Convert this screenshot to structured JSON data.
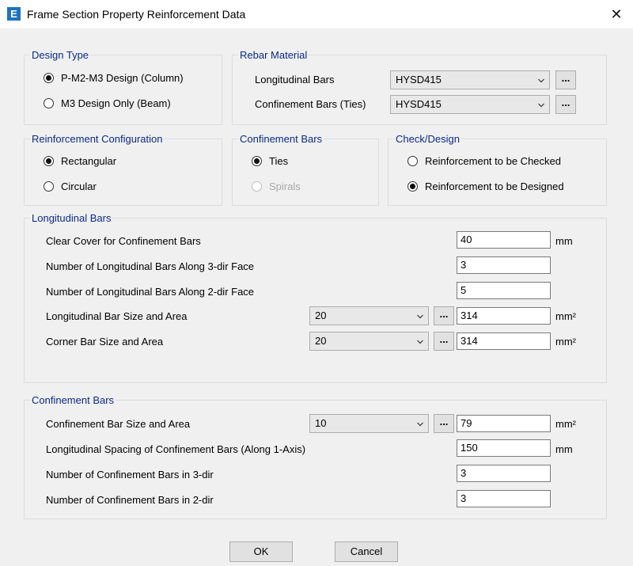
{
  "window": {
    "title": "Frame Section Property Reinforcement Data",
    "close_symbol": "✕"
  },
  "design_type": {
    "legend": "Design Type",
    "options": [
      {
        "label": "P-M2-M3 Design  (Column)",
        "selected": true
      },
      {
        "label": "M3 Design Only  (Beam)",
        "selected": false
      }
    ]
  },
  "rebar_material": {
    "legend": "Rebar Material",
    "longitudinal_label": "Longitudinal Bars",
    "longitudinal_value": "HYSD415",
    "confinement_label": "Confinement Bars (Ties)",
    "confinement_value": "HYSD415"
  },
  "reinforcement_configuration": {
    "legend": "Reinforcement Configuration",
    "options": [
      {
        "label": "Rectangular",
        "selected": true
      },
      {
        "label": "Circular",
        "selected": false
      }
    ]
  },
  "confinement_type": {
    "legend": "Confinement Bars",
    "options": [
      {
        "label": "Ties",
        "selected": true
      },
      {
        "label": "Spirals",
        "selected": false,
        "disabled": true
      }
    ]
  },
  "check_design": {
    "legend": "Check/Design",
    "options": [
      {
        "label": "Reinforcement to be Checked",
        "selected": false
      },
      {
        "label": "Reinforcement to be Designed",
        "selected": true
      }
    ]
  },
  "longitudinal_bars": {
    "legend": "Longitudinal Bars",
    "clear_cover_label": "Clear Cover for Confinement Bars",
    "clear_cover_value": "40",
    "clear_cover_unit": "mm",
    "bars_3dir_label": "Number of Longitudinal Bars Along 3-dir Face",
    "bars_3dir_value": "3",
    "bars_2dir_label": "Number of Longitudinal Bars Along 2-dir Face",
    "bars_2dir_value": "5",
    "bar_size_label": "Longitudinal Bar Size and Area",
    "bar_size_value": "20",
    "bar_area_value": "314",
    "bar_area_unit": "mm²",
    "corner_label": "Corner Bar Size and Area",
    "corner_size_value": "20",
    "corner_area_value": "314",
    "corner_area_unit": "mm²"
  },
  "confinement_bars": {
    "legend": "Confinement Bars",
    "size_label": "Confinement Bar Size and Area",
    "size_value": "10",
    "area_value": "79",
    "area_unit": "mm²",
    "spacing_label": "Longitudinal Spacing of Confinement Bars  (Along 1-Axis)",
    "spacing_value": "150",
    "spacing_unit": "mm",
    "count_3dir_label": "Number of Confinement Bars in 3-dir",
    "count_3dir_value": "3",
    "count_2dir_label": "Number of Confinement Bars in 2-dir",
    "count_2dir_value": "3"
  },
  "ellipsis_label": "...",
  "buttons": {
    "ok": "OK",
    "cancel": "Cancel"
  }
}
